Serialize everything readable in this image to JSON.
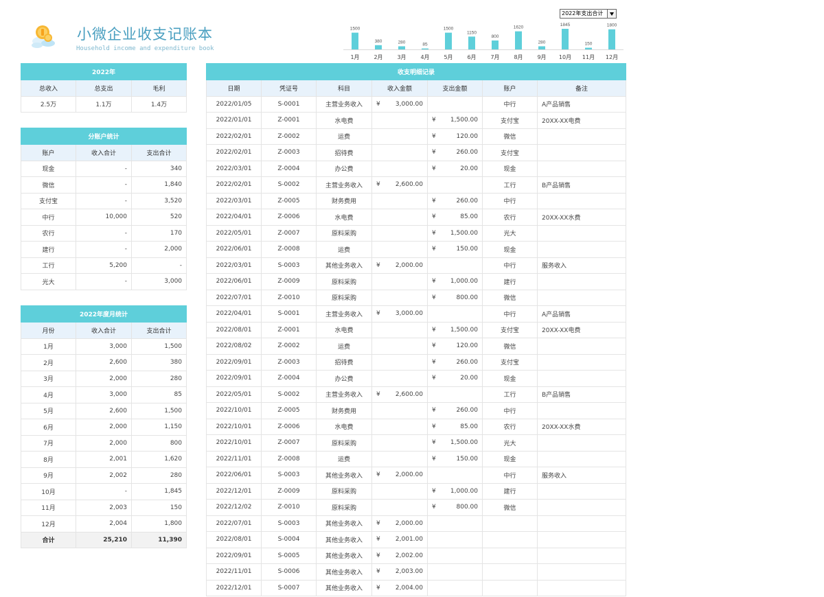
{
  "header": {
    "title": "小微企业收支记账本",
    "subtitle": "Household income and expenditure book"
  },
  "chart_select": {
    "value": "2022年支出合计"
  },
  "chart_data": {
    "type": "bar",
    "categories": [
      "1月",
      "2月",
      "3月",
      "4月",
      "5月",
      "6月",
      "7月",
      "8月",
      "9月",
      "10月",
      "11月",
      "12月"
    ],
    "values": [
      1500,
      380,
      280,
      85,
      1500,
      1150,
      800,
      1620,
      280,
      1845,
      150,
      1800
    ],
    "title": "",
    "color": "#5ecfda"
  },
  "year_summary": {
    "caption": "2022年",
    "headers": [
      "总收入",
      "总支出",
      "毛利"
    ],
    "values": [
      "2.5万",
      "1.1万",
      "1.4万"
    ]
  },
  "account_stats": {
    "caption": "分账户统计",
    "headers": [
      "账户",
      "收入合计",
      "支出合计"
    ],
    "rows": [
      [
        "现金",
        "-",
        "340"
      ],
      [
        "微信",
        "-",
        "1,840"
      ],
      [
        "支付宝",
        "-",
        "3,520"
      ],
      [
        "中行",
        "10,000",
        "520"
      ],
      [
        "农行",
        "-",
        "170"
      ],
      [
        "建行",
        "-",
        "2,000"
      ],
      [
        "工行",
        "5,200",
        "-"
      ],
      [
        "光大",
        "-",
        "3,000"
      ]
    ]
  },
  "monthly_stats": {
    "caption": "2022年度月统计",
    "headers": [
      "月份",
      "收入合计",
      "支出合计"
    ],
    "rows": [
      [
        "1月",
        "3,000",
        "1,500"
      ],
      [
        "2月",
        "2,600",
        "380"
      ],
      [
        "3月",
        "2,000",
        "280"
      ],
      [
        "4月",
        "3,000",
        "85"
      ],
      [
        "5月",
        "2,600",
        "1,500"
      ],
      [
        "6月",
        "2,000",
        "1,150"
      ],
      [
        "7月",
        "2,000",
        "800"
      ],
      [
        "8月",
        "2,001",
        "1,620"
      ],
      [
        "9月",
        "2,002",
        "280"
      ],
      [
        "10月",
        "-",
        "1,845"
      ],
      [
        "11月",
        "2,003",
        "150"
      ],
      [
        "12月",
        "2,004",
        "1,800"
      ]
    ],
    "total": [
      "合计",
      "25,210",
      "11,390"
    ]
  },
  "ledger": {
    "caption": "收支明细记录",
    "headers": [
      "日期",
      "凭证号",
      "科目",
      "收入金额",
      "支出金额",
      "账户",
      "备注"
    ],
    "currency_symbol": "¥",
    "rows": [
      [
        "2022/01/05",
        "S-0001",
        "主营业务收入",
        "3,000.00",
        "",
        "中行",
        "A产品销售"
      ],
      [
        "2022/01/01",
        "Z-0001",
        "水电费",
        "",
        "1,500.00",
        "支付宝",
        "20XX-XX电费"
      ],
      [
        "2022/02/01",
        "Z-0002",
        "运费",
        "",
        "120.00",
        "微信",
        ""
      ],
      [
        "2022/02/01",
        "Z-0003",
        "招待费",
        "",
        "260.00",
        "支付宝",
        ""
      ],
      [
        "2022/03/01",
        "Z-0004",
        "办公费",
        "",
        "20.00",
        "现金",
        ""
      ],
      [
        "2022/02/01",
        "S-0002",
        "主营业务收入",
        "2,600.00",
        "",
        "工行",
        "B产品销售"
      ],
      [
        "2022/03/01",
        "Z-0005",
        "财务费用",
        "",
        "260.00",
        "中行",
        ""
      ],
      [
        "2022/04/01",
        "Z-0006",
        "水电费",
        "",
        "85.00",
        "农行",
        "20XX-XX水费"
      ],
      [
        "2022/05/01",
        "Z-0007",
        "原料采购",
        "",
        "1,500.00",
        "光大",
        ""
      ],
      [
        "2022/06/01",
        "Z-0008",
        "运费",
        "",
        "150.00",
        "现金",
        ""
      ],
      [
        "2022/03/01",
        "S-0003",
        "其他业务收入",
        "2,000.00",
        "",
        "中行",
        "服务收入"
      ],
      [
        "2022/06/01",
        "Z-0009",
        "原料采购",
        "",
        "1,000.00",
        "建行",
        ""
      ],
      [
        "2022/07/01",
        "Z-0010",
        "原料采购",
        "",
        "800.00",
        "微信",
        ""
      ],
      [
        "2022/04/01",
        "S-0001",
        "主营业务收入",
        "3,000.00",
        "",
        "中行",
        "A产品销售"
      ],
      [
        "2022/08/01",
        "Z-0001",
        "水电费",
        "",
        "1,500.00",
        "支付宝",
        "20XX-XX电费"
      ],
      [
        "2022/08/02",
        "Z-0002",
        "运费",
        "",
        "120.00",
        "微信",
        ""
      ],
      [
        "2022/09/01",
        "Z-0003",
        "招待费",
        "",
        "260.00",
        "支付宝",
        ""
      ],
      [
        "2022/09/01",
        "Z-0004",
        "办公费",
        "",
        "20.00",
        "现金",
        ""
      ],
      [
        "2022/05/01",
        "S-0002",
        "主营业务收入",
        "2,600.00",
        "",
        "工行",
        "B产品销售"
      ],
      [
        "2022/10/01",
        "Z-0005",
        "财务费用",
        "",
        "260.00",
        "中行",
        ""
      ],
      [
        "2022/10/01",
        "Z-0006",
        "水电费",
        "",
        "85.00",
        "农行",
        "20XX-XX水费"
      ],
      [
        "2022/10/01",
        "Z-0007",
        "原料采购",
        "",
        "1,500.00",
        "光大",
        ""
      ],
      [
        "2022/11/01",
        "Z-0008",
        "运费",
        "",
        "150.00",
        "现金",
        ""
      ],
      [
        "2022/06/01",
        "S-0003",
        "其他业务收入",
        "2,000.00",
        "",
        "中行",
        "服务收入"
      ],
      [
        "2022/12/01",
        "Z-0009",
        "原料采购",
        "",
        "1,000.00",
        "建行",
        ""
      ],
      [
        "2022/12/02",
        "Z-0010",
        "原料采购",
        "",
        "800.00",
        "微信",
        ""
      ],
      [
        "2022/07/01",
        "S-0003",
        "其他业务收入",
        "2,000.00",
        "",
        "",
        ""
      ],
      [
        "2022/08/01",
        "S-0004",
        "其他业务收入",
        "2,001.00",
        "",
        "",
        ""
      ],
      [
        "2022/09/01",
        "S-0005",
        "其他业务收入",
        "2,002.00",
        "",
        "",
        ""
      ],
      [
        "2022/11/01",
        "S-0006",
        "其他业务收入",
        "2,003.00",
        "",
        "",
        ""
      ],
      [
        "2022/12/01",
        "S-0007",
        "其他业务收入",
        "2,004.00",
        "",
        "",
        ""
      ]
    ]
  }
}
